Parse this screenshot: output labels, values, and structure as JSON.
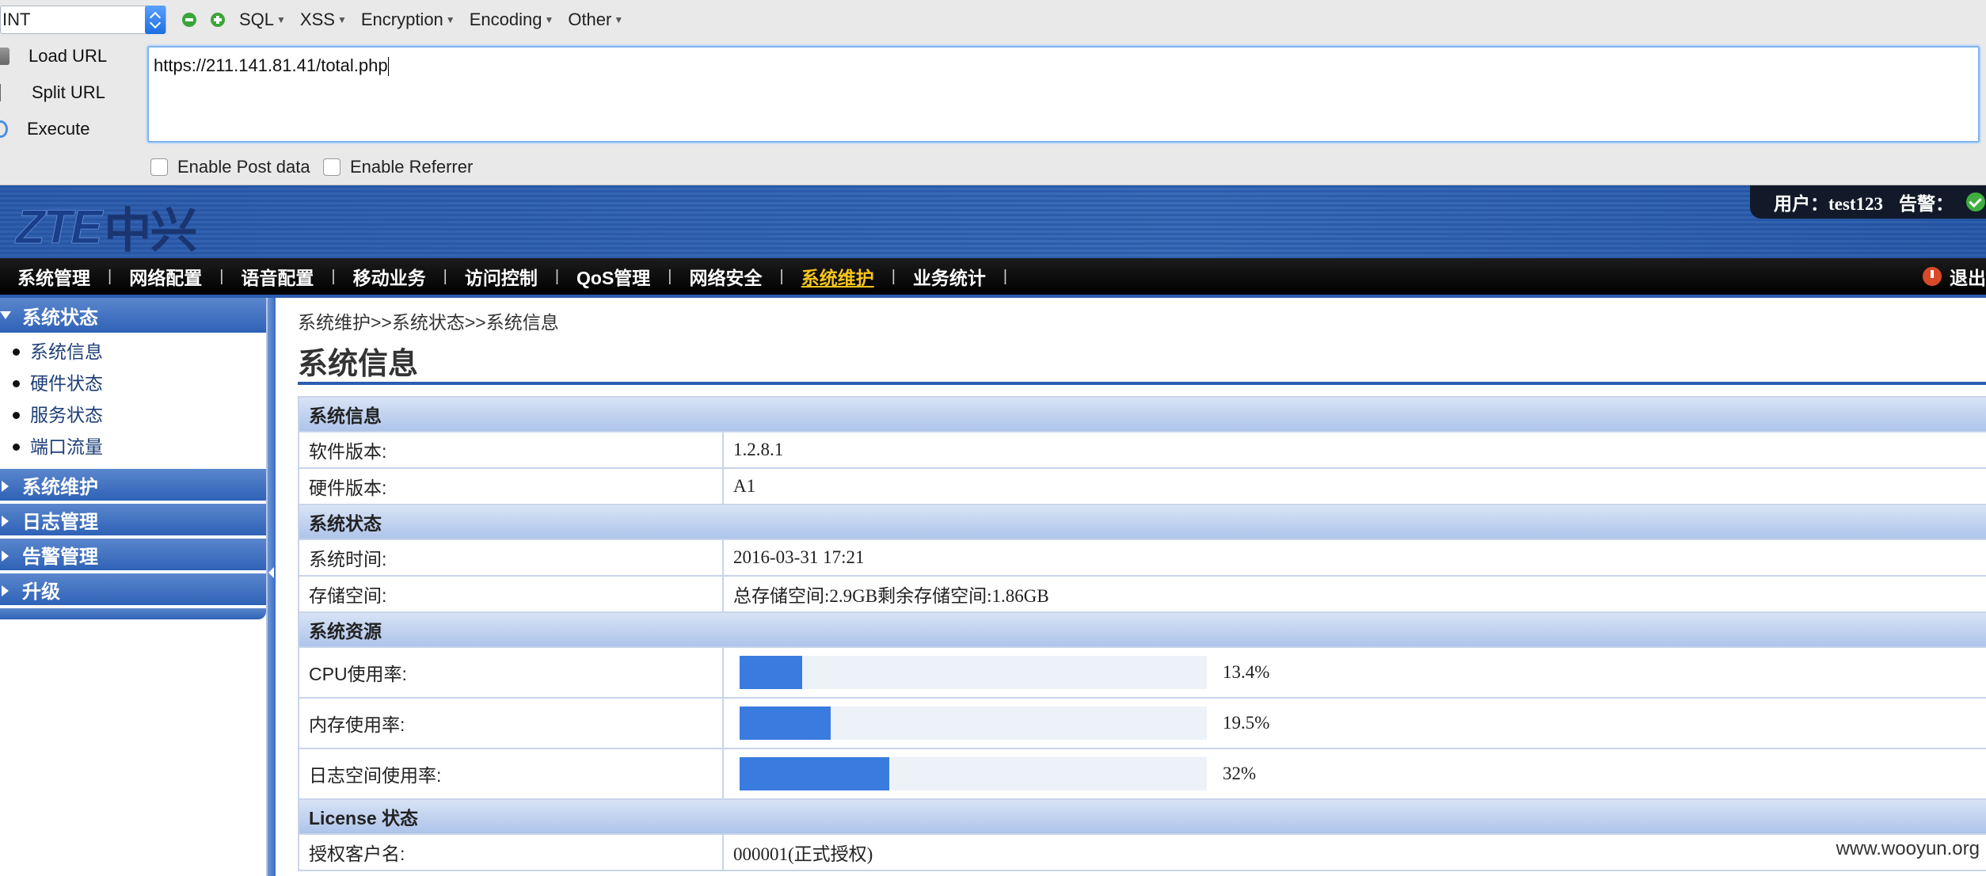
{
  "hackbar": {
    "select_value": "INT",
    "menus": [
      "SQL",
      "XSS",
      "Encryption",
      "Encoding",
      "Other"
    ],
    "load_url": "Load URL",
    "split_url": "Split URL",
    "execute": "Execute",
    "url": "https://211.141.81.41/total.php",
    "enable_post": "Enable Post data",
    "enable_referrer": "Enable Referrer"
  },
  "header": {
    "logo_latin": "ZTE",
    "logo_cn": "中兴",
    "user_label": "用户：test123",
    "alarm_label": "告警："
  },
  "nav": {
    "items": [
      "系统管理",
      "网络配置",
      "语音配置",
      "移动业务",
      "访问控制",
      "QoS管理",
      "网络安全",
      "系统维护",
      "业务统计"
    ],
    "active": "系统维护",
    "separator": "|",
    "logout": "退出"
  },
  "sidebar": {
    "open_group": "系统状态",
    "sub_items": [
      "系统信息",
      "硬件状态",
      "服务状态",
      "端口流量"
    ],
    "groups": [
      "系统维护",
      "日志管理",
      "告警管理",
      "升级"
    ]
  },
  "content": {
    "breadcrumb": "系统维护>>系统状态>>系统信息",
    "title": "系统信息",
    "sections": {
      "info": "系统信息",
      "status": "系统状态",
      "resources": "系统资源",
      "license": "License 状态"
    },
    "rows": {
      "software_label": "软件版本:",
      "software_value": "1.2.8.1",
      "hardware_label": "硬件版本:",
      "hardware_value": "A1",
      "time_label": "系统时间:",
      "time_value": "2016-03-31 17:21",
      "storage_label": "存储空间:",
      "storage_value": "总存储空间:2.9GB剩余存储空间:1.86GB",
      "cpu_label": "CPU使用率:",
      "cpu_value": "13.4%",
      "cpu_fraction": 0.134,
      "mem_label": "内存使用率:",
      "mem_value": "19.5%",
      "mem_fraction": 0.195,
      "log_label": "日志空间使用率:",
      "log_value": "32%",
      "log_fraction": 0.32,
      "customer_label": "授权客户名:",
      "customer_value": "000001(正式授权)"
    }
  },
  "watermark": "www.wooyun.org"
}
